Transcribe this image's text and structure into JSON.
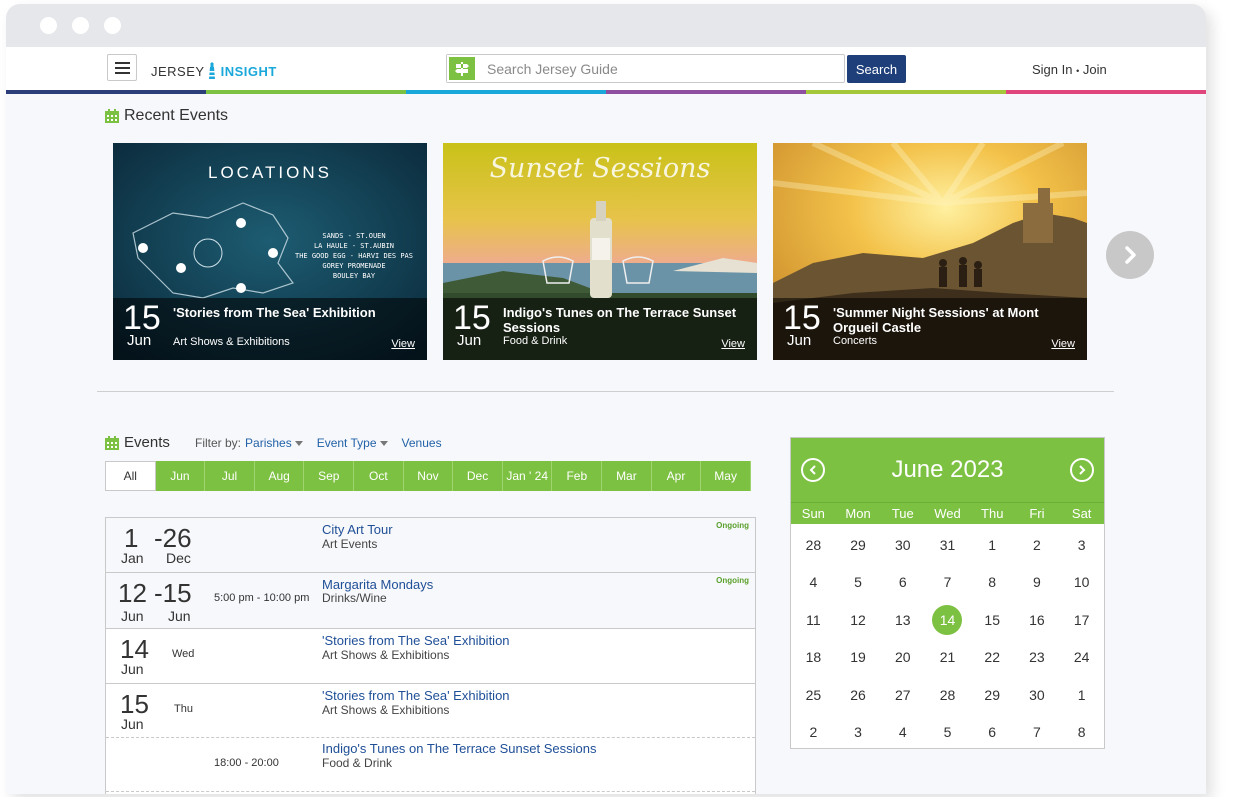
{
  "header": {
    "logo_part1": "JERSEY",
    "logo_part2": "INSIGHT",
    "search_placeholder": "Search Jersey Guide",
    "search_button": "Search",
    "sign_in": "Sign In",
    "join": "Join"
  },
  "stripe_colors": [
    "#2c3e7a",
    "#7dc142",
    "#1aa7d9",
    "#8e4fa0",
    "#a5c83b",
    "#e0457b"
  ],
  "recent": {
    "title": "Recent Events",
    "cards": [
      {
        "day": "15",
        "month": "Jun",
        "title": "'Stories from The Sea' Exhibition",
        "category": "Art Shows & Exhibitions",
        "view": "View",
        "image_heading": "LOCATIONS",
        "image_lines": [
          "SANDS - ST.OUEN",
          "LA HAULE - ST.AUBIN",
          "THE GOOD EGG - HARVI DES PAS",
          "GOREY PROMENADE",
          "BOULEY BAY"
        ]
      },
      {
        "day": "15",
        "month": "Jun",
        "title": "Indigo's Tunes on The Terrace Sunset Sessions",
        "category": "Food & Drink",
        "view": "View",
        "image_heading": "Sunset Sessions"
      },
      {
        "day": "15",
        "month": "Jun",
        "title": "'Summer Night Sessions' at Mont Orgueil Castle",
        "category": "Concerts",
        "view": "View"
      }
    ]
  },
  "events": {
    "title": "Events",
    "filter_label": "Filter by:",
    "filters": [
      "Parishes",
      "Event Type",
      "Venues"
    ],
    "months": [
      "All",
      "Jun",
      "Jul",
      "Aug",
      "Sep",
      "Oct",
      "Nov",
      "Dec",
      "Jan ' 24",
      "Feb",
      "Mar",
      "Apr",
      "May"
    ],
    "rows": [
      {
        "d1": "1",
        "d2": "-26",
        "m1": "Jan",
        "m2": "Dec",
        "weekday": "",
        "time": "",
        "title": "City Art Tour",
        "category": "Art Events",
        "badge": "Ongoing"
      },
      {
        "d1": "12",
        "d2": "-15",
        "m1": "Jun",
        "m2": "Jun",
        "weekday": "",
        "time": "5:00 pm - 10:00 pm",
        "title": "Margarita Mondays",
        "category": "Drinks/Wine",
        "badge": "Ongoing"
      },
      {
        "d1": "14",
        "d2": "",
        "m1": "Jun",
        "m2": "",
        "weekday": "Wed",
        "time": "",
        "title": "'Stories from The Sea' Exhibition",
        "category": "Art Shows & Exhibitions",
        "badge": ""
      },
      {
        "d1": "15",
        "d2": "",
        "m1": "Jun",
        "m2": "",
        "weekday": "Thu",
        "time": "",
        "title": "'Stories from The Sea' Exhibition",
        "category": "Art Shows & Exhibitions",
        "badge": ""
      },
      {
        "d1": "",
        "d2": "",
        "m1": "",
        "m2": "",
        "weekday": "",
        "time": "18:00 - 20:00",
        "title": "Indigo's Tunes on The Terrace Sunset Sessions",
        "category": "Food & Drink",
        "badge": ""
      }
    ]
  },
  "calendar": {
    "title": "June 2023",
    "weekdays": [
      "Sun",
      "Mon",
      "Tue",
      "Wed",
      "Thu",
      "Fri",
      "Sat"
    ],
    "days": [
      "28",
      "29",
      "30",
      "31",
      "1",
      "2",
      "3",
      "4",
      "5",
      "6",
      "7",
      "8",
      "9",
      "10",
      "11",
      "12",
      "13",
      "14",
      "15",
      "16",
      "17",
      "18",
      "19",
      "20",
      "21",
      "22",
      "23",
      "24",
      "25",
      "26",
      "27",
      "28",
      "29",
      "30",
      "1",
      "2",
      "3",
      "4",
      "5",
      "6",
      "7",
      "8"
    ],
    "today": "14"
  }
}
